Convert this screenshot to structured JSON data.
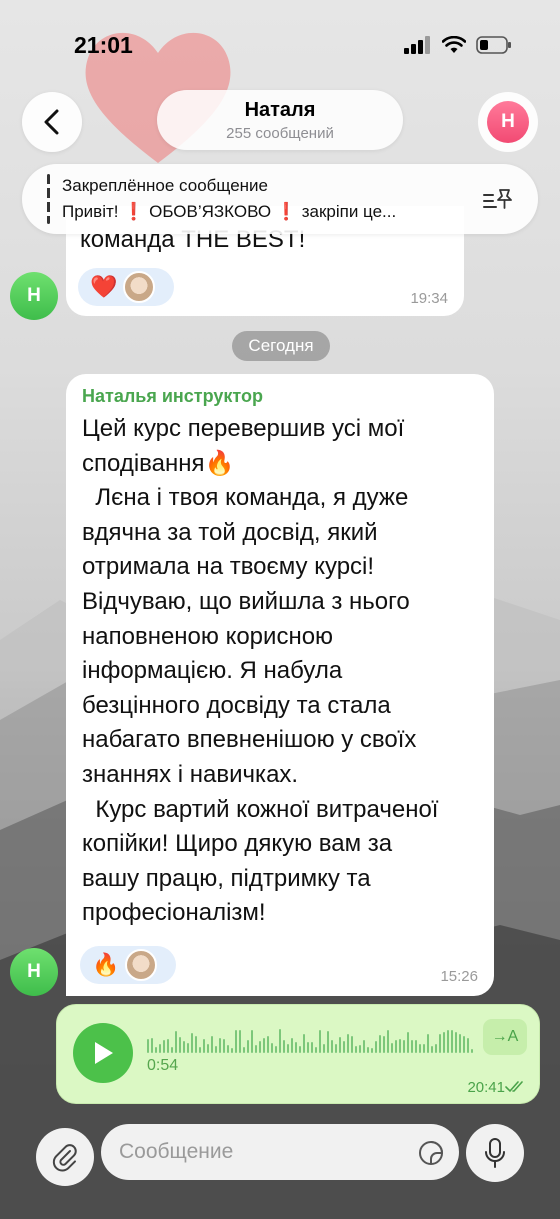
{
  "status_bar": {
    "time": "21:01"
  },
  "header": {
    "title": "Наталя",
    "subtitle": "255 сообщений",
    "avatar_initial": "Н"
  },
  "pinned": {
    "title": "Закреплённое сообщение",
    "text": "Привіт! ❗ ОБОВ’ЯЗКОВО ❗ закріпи це..."
  },
  "messages": [
    {
      "text": "команда THE  BEST!",
      "reaction": "❤️",
      "time": "19:34",
      "avatar_initial": "Н"
    },
    {
      "sender": "Наталья инструктор",
      "lines": [
        "Цей курс перевершив усі мої",
        "сподівання🔥",
        "  Лєна і твоя команда, я дуже",
        "вдячна за той досвід, який",
        "отримала на твоєму курсі!",
        "Відчуваю, що вийшла з нього",
        "наповненою корисною",
        "інформацією. Я набула",
        "безцінного досвіду та стала",
        "набагато впевненішою у своїх",
        "знаннях і навичках.",
        "  Курс вартий кожної витраченої",
        "копійки! Щиро дякую вам за",
        "вашу працю, підтримку та",
        "професіоналізм!"
      ],
      "reaction": "🔥",
      "time": "15:26",
      "avatar_initial": "Н"
    }
  ],
  "date_separator": "Сегодня",
  "voice_message": {
    "duration": "0:54",
    "transcribe_label": "→A",
    "time": "20:41"
  },
  "input": {
    "placeholder": "Сообщение"
  },
  "colors": {
    "accent_green": "#4cc14a",
    "outgoing_bubble": "#dbf8c4",
    "sender_name": "#4aa64f",
    "avatar_pink": "#f24a73"
  }
}
